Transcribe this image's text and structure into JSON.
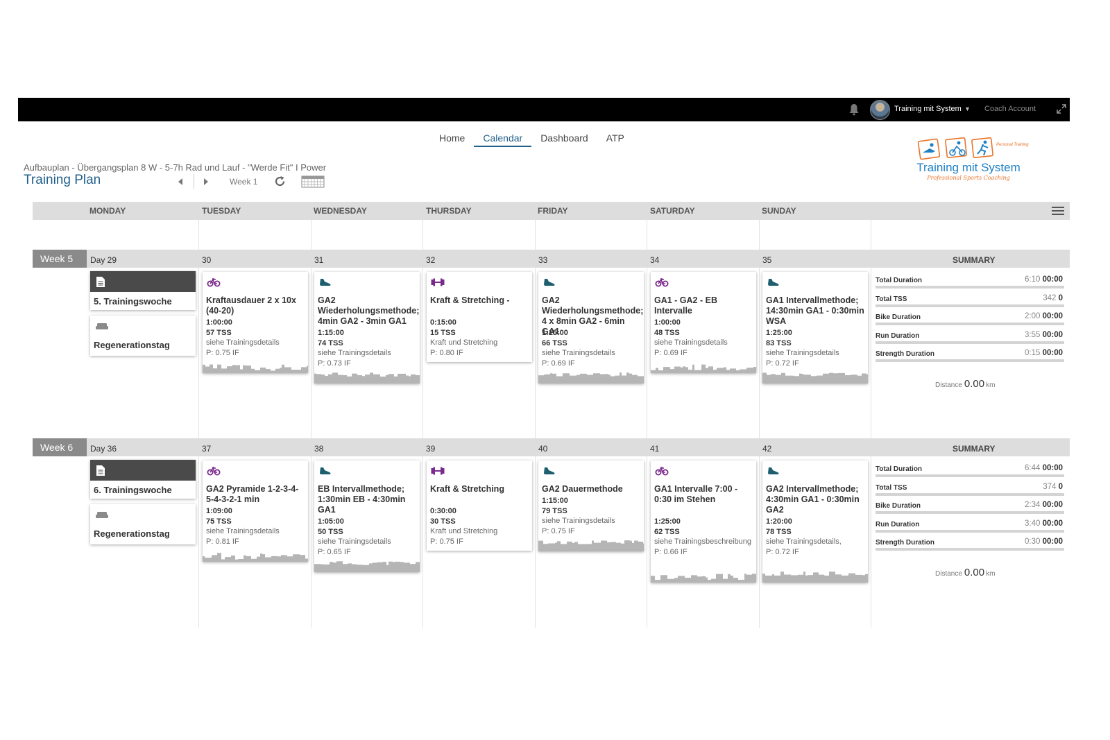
{
  "topbar": {
    "user_name": "Training mit System",
    "coach_account": "Coach Account",
    "icons": [
      "bell-icon",
      "avatar",
      "caret-down-icon",
      "expand-icon"
    ]
  },
  "nav": {
    "items": [
      "Home",
      "Calendar",
      "Dashboard",
      "ATP"
    ],
    "active": "Calendar"
  },
  "logo": {
    "name": "Training mit System",
    "tagline": "Professional Sports Coaching",
    "badge": "Personal Training"
  },
  "plan": {
    "subtitle": "Aufbauplan - Übergangsplan 8 W - 5-7h Rad und Lauf - \"Werde Fit\" I Power",
    "title": "Training Plan",
    "week_label": "Week 1"
  },
  "days": [
    "MONDAY",
    "TUESDAY",
    "WEDNESDAY",
    "THURSDAY",
    "FRIDAY",
    "SATURDAY",
    "SUNDAY"
  ],
  "summary_title": "SUMMARY",
  "weeks": [
    {
      "label": "Week 5",
      "day_numbers": [
        "Day 29",
        "30",
        "31",
        "32",
        "33",
        "34",
        "35"
      ],
      "notes": [
        "5. Trainingswoche",
        "Regenerationstag"
      ],
      "workouts": [
        {
          "sport": "bike-icon",
          "title": "Kraftausdauer 2 x 10x (40-20)",
          "duration": "1:00:00",
          "tss": "57 TSS",
          "desc": "siehe Trainingsdetails",
          "pif": "P: 0.75 IF"
        },
        {
          "sport": "run-shoe-icon",
          "title": "GA2 Wiederholungsmethode; 4min GA2 - 3min GA1",
          "duration": "1:15:00",
          "tss": "74 TSS",
          "desc": "siehe Trainingsdetails",
          "pif": "P: 0.73 IF"
        },
        {
          "sport": "strength-icon",
          "title": "Kraft & Stretching -",
          "duration": "0:15:00",
          "tss": "15 TSS",
          "desc": "Kraft und Stretching",
          "pif": "P: 0.80 IF"
        },
        {
          "sport": "run-shoe-icon",
          "title": "GA2 Wiederholungsmethode; 4 x 8min GA2 - 6min GA1",
          "duration": "1:15:00",
          "tss": "66 TSS",
          "desc": "siehe Trainingsdetails",
          "pif": "P: 0.69 IF"
        },
        {
          "sport": "bike-icon",
          "title": "GA1 - GA2 - EB Intervalle",
          "duration": "1:00:00",
          "tss": "48 TSS",
          "desc": "siehe Trainingsdetails",
          "pif": "P: 0.69 IF"
        },
        {
          "sport": "run-shoe-icon",
          "title": "GA1 Intervallmethode; 14:30min GA1 - 0:30min WSA",
          "duration": "1:25:00",
          "tss": "83 TSS",
          "desc": "siehe Trainingsdetails",
          "pif": "P: 0.72 IF"
        }
      ],
      "summary": [
        {
          "label": "Total Duration",
          "planned": "6:10",
          "done": "00:00"
        },
        {
          "label": "Total TSS",
          "planned": "342",
          "done": "0"
        },
        {
          "label": "Bike Duration",
          "planned": "2:00",
          "done": "00:00"
        },
        {
          "label": "Run Duration",
          "planned": "3:55",
          "done": "00:00"
        },
        {
          "label": "Strength Duration",
          "planned": "0:15",
          "done": "00:00"
        }
      ],
      "distance": {
        "label": "Distance",
        "value": "0.00",
        "unit": "km"
      }
    },
    {
      "label": "Week 6",
      "day_numbers": [
        "Day 36",
        "37",
        "38",
        "39",
        "40",
        "41",
        "42"
      ],
      "notes": [
        "6. Trainingswoche",
        "Regenerationstag"
      ],
      "workouts": [
        {
          "sport": "bike-icon",
          "title": "GA2 Pyramide 1-2-3-4-5-4-3-2-1 min",
          "duration": "1:09:00",
          "tss": "75 TSS",
          "desc": "siehe Trainingsdetails",
          "pif": "P: 0.81 IF"
        },
        {
          "sport": "run-shoe-icon",
          "title": "EB Intervallmethode; 1:30min EB - 4:30min GA1",
          "duration": "1:05:00",
          "tss": "50 TSS",
          "desc": "siehe Trainingsdetails",
          "pif": "P: 0.65 IF"
        },
        {
          "sport": "strength-icon",
          "title": "Kraft & Stretching",
          "duration": "0:30:00",
          "tss": "30 TSS",
          "desc": "Kraft und Stretching",
          "pif": "P: 0.75 IF"
        },
        {
          "sport": "run-shoe-icon",
          "title": "GA2 Dauermethode",
          "duration": "1:15:00",
          "tss": "79 TSS",
          "desc": "siehe Trainingsdetails",
          "pif": "P: 0.75 IF"
        },
        {
          "sport": "bike-icon",
          "title": "GA1 Intervalle 7:00 - 0:30 im Stehen",
          "duration": "1:25:00",
          "tss": "62 TSS",
          "desc": "siehe Trainingsbeschreibung",
          "pif": "P: 0.66 IF"
        },
        {
          "sport": "run-shoe-icon",
          "title": "GA2 Intervallmethode; 4:30min GA1 - 0:30min GA2",
          "duration": "1:20:00",
          "tss": "78 TSS",
          "desc": "siehe Trainingsdetails,",
          "pif": "P: 0.72 IF"
        }
      ],
      "summary": [
        {
          "label": "Total Duration",
          "planned": "6:44",
          "done": "00:00"
        },
        {
          "label": "Total TSS",
          "planned": "374",
          "done": "0"
        },
        {
          "label": "Bike Duration",
          "planned": "2:34",
          "done": "00:00"
        },
        {
          "label": "Run Duration",
          "planned": "3:40",
          "done": "00:00"
        },
        {
          "label": "Strength Duration",
          "planned": "0:30",
          "done": "00:00"
        }
      ],
      "distance": {
        "label": "Distance",
        "value": "0.00",
        "unit": "km"
      }
    }
  ],
  "colors": {
    "accent": "#1f5f8b",
    "bike": "#7a2a8c",
    "run": "#1d5f6e",
    "strength": "#7a2a8c",
    "topbar": "#000000",
    "header_bg": "#dddddd",
    "profile": "#b5b5b5"
  }
}
